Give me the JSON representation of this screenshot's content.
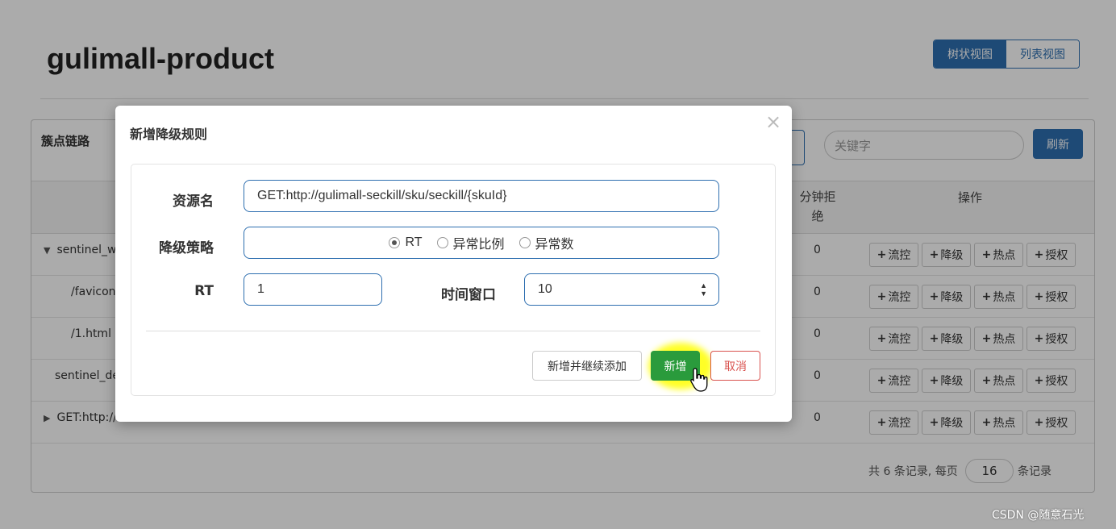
{
  "page": {
    "app_title": "gulimall-product",
    "view_tree_label": "树状视图",
    "view_list_label": "列表视图",
    "panel_title": "簇点链路",
    "keyword_placeholder": "关键字",
    "refresh_label": "刷新",
    "col_reject": "分钟拒绝",
    "col_ops": "操作",
    "op_buttons": [
      "流控",
      "降级",
      "热点",
      "授权"
    ],
    "rows": [
      {
        "label": "sentinel_w",
        "expand": "▼",
        "value": "0"
      },
      {
        "label": "/favicon.",
        "expand": "",
        "value": "0"
      },
      {
        "label": "/1.html",
        "expand": "",
        "value": "0"
      },
      {
        "label": "sentinel_de",
        "expand": "",
        "value": "0"
      },
      {
        "label": "GET:http://",
        "expand": "▶",
        "value": "0"
      }
    ],
    "footer_prefix": "共 6 条记录, 每页",
    "page_size": "16",
    "footer_suffix": "条记录"
  },
  "modal": {
    "title": "新增降级规则",
    "close_icon": "close-icon",
    "resource_label": "资源名",
    "resource_value": "GET:http://gulimall-seckill/sku/seckill/{skuId}",
    "strategy_label": "降级策略",
    "strategy_options": [
      "RT",
      "异常比例",
      "异常数"
    ],
    "strategy_selected": "RT",
    "rt_label": "RT",
    "rt_value": "1",
    "window_label": "时间窗口",
    "window_value": "10",
    "btn_continue": "新增并继续添加",
    "btn_add": "新增",
    "btn_cancel": "取消"
  },
  "watermark": "CSDN @随意石光",
  "colors": {
    "primary": "#2e6fb0",
    "success": "#2a9b3c",
    "danger": "#d9534f"
  }
}
